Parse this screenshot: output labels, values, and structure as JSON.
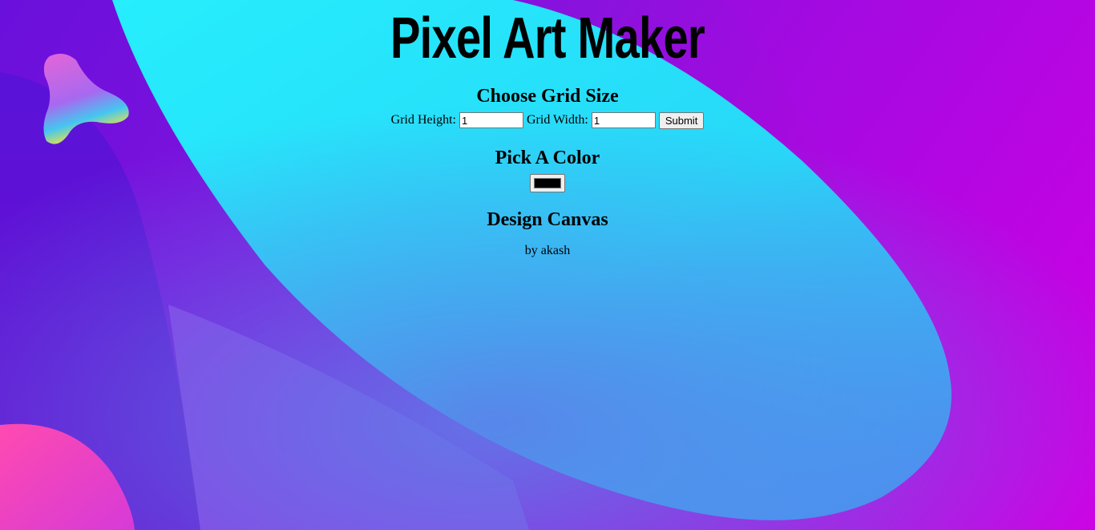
{
  "app": {
    "title": "Pixel Art Maker"
  },
  "grid_size": {
    "heading": "Choose Grid Size",
    "height_label": "Grid Height:",
    "height_value": "1",
    "width_label": "Grid Width:",
    "width_value": "1",
    "submit_label": "Submit"
  },
  "color": {
    "heading": "Pick A Color",
    "selected_color": "#000000"
  },
  "canvas": {
    "heading": "Design Canvas"
  },
  "footer": {
    "credit": "by akash"
  },
  "theme": {
    "background_primary": "#7a12d8",
    "background_accent": "#25e6fb",
    "background_magenta": "#c800e2"
  }
}
